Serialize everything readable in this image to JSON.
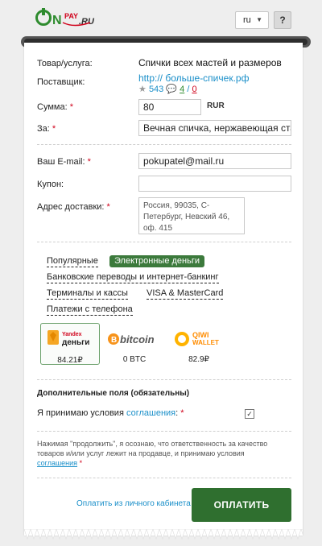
{
  "header": {
    "logo_text": "ONPAY.RU",
    "lang_value": "ru",
    "help_label": "?"
  },
  "form": {
    "product_label": "Товар/услуга:",
    "product_value": "Спички всех мастей и размеров",
    "supplier_label": "Поставщик:",
    "supplier_link": "http:// больше-спичек.рф",
    "supplier_stats": {
      "rating": "543",
      "positive": "4",
      "negative": "0"
    },
    "amount_label": "Сумма:",
    "amount_value": "80",
    "currency": "RUR",
    "for_label": "За:",
    "for_value": "Вечная спичка, нержавеющая сталь",
    "email_label": "Ваш E-mail:",
    "email_value": "pokupatel@mail.ru",
    "coupon_label": "Купон:",
    "coupon_value": "",
    "address_label": "Адрес доставки:",
    "address_value": "Россия, 99035, С-Петербург, Невский 46, оф. 415",
    "required_mark": "*"
  },
  "payment_tabs": [
    {
      "label": "Популярные",
      "active": false
    },
    {
      "label": "Электронные деньги",
      "active": true
    },
    {
      "label": "Банковские переводы и интернет-банкинг",
      "active": false
    },
    {
      "label": "Терминалы и кассы",
      "active": false
    },
    {
      "label": "VISA & MasterCard",
      "active": false
    },
    {
      "label": "Платежи с телефона",
      "active": false
    }
  ],
  "payment_options": [
    {
      "name": "Яндекс деньги",
      "brand_small": "Yandex",
      "brand_big": "деньги",
      "amount": "84.21₽",
      "selected": true
    },
    {
      "name": "bitcoin",
      "amount": "0 BTC",
      "selected": false
    },
    {
      "name": "QIWI WALLET",
      "amount": "82.9₽",
      "selected": false
    }
  ],
  "extra": {
    "section_title": "Дополнительные поля (обязательны)",
    "agree_prefix": "Я принимаю условия ",
    "agree_link": "соглашения",
    "agree_suffix": ":",
    "notice_text": "Нажимая \"продолжить\", я осознаю, что ответственность за качество товаров и/или услуг лежит на продавце, и принимаю условия ",
    "notice_link": "соглашения"
  },
  "actions": {
    "cabinet_link": "Оплатить из личного кабинета",
    "pay_button": "ОПЛАТИТЬ"
  },
  "colors": {
    "brand_green": "#2f6f2f",
    "link_blue": "#1a8fc9",
    "required_red": "#d0021b"
  }
}
